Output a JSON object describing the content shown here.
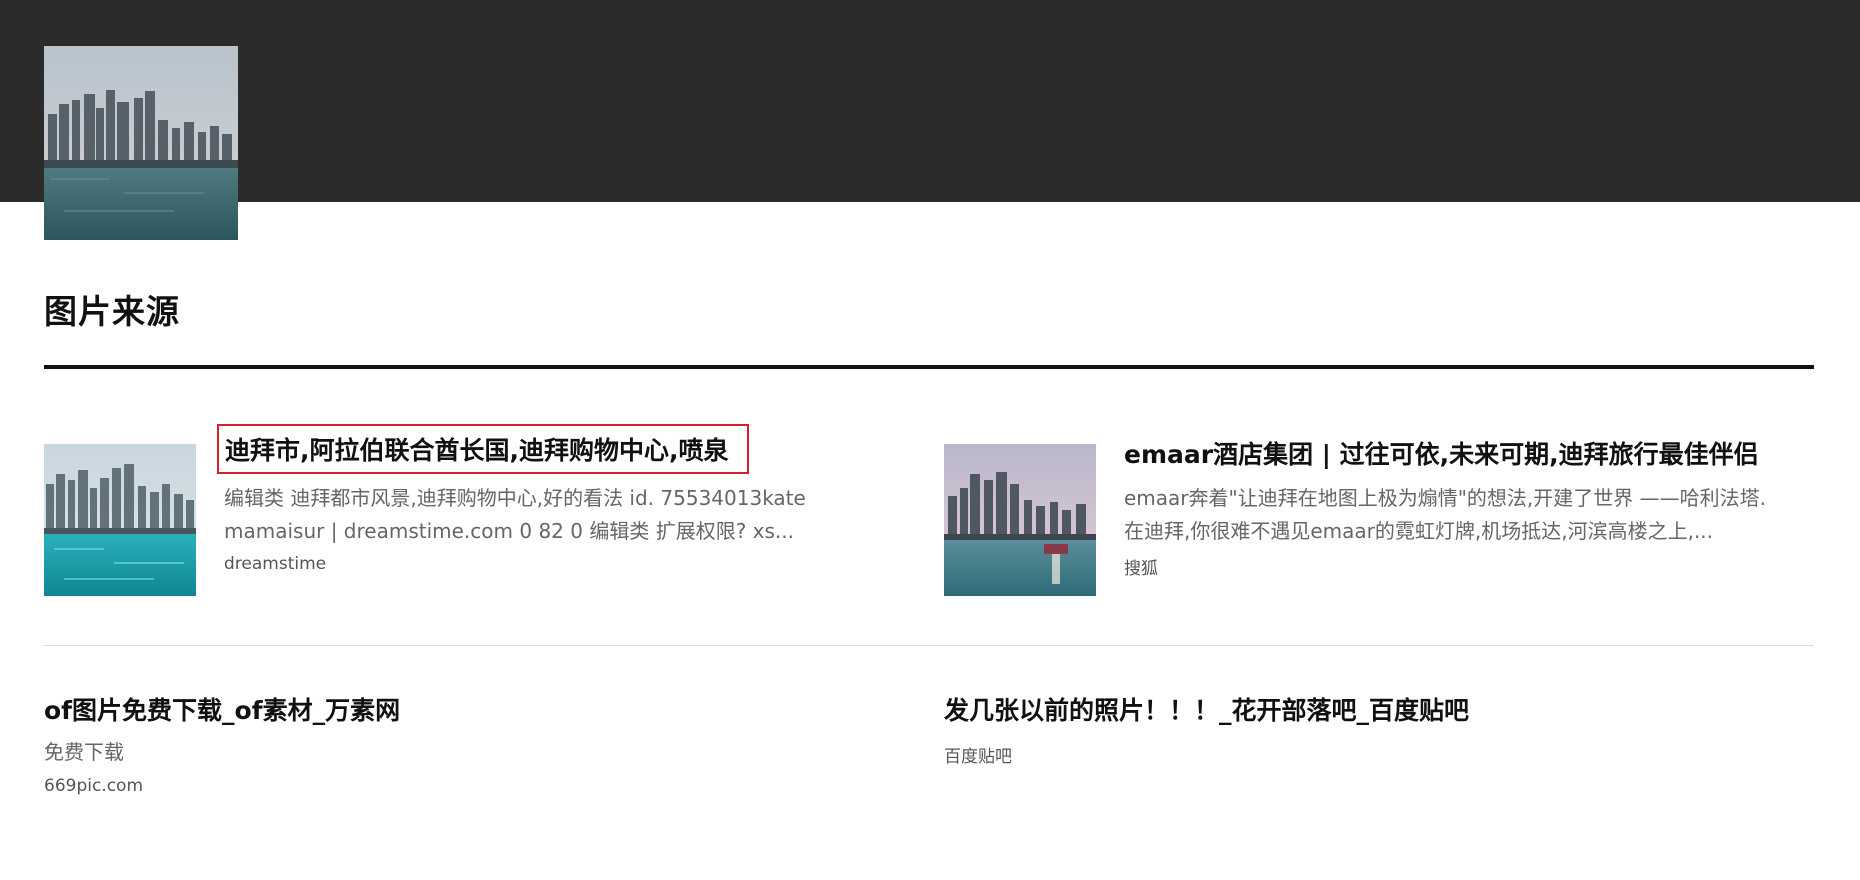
{
  "hero": {
    "image_name": "dubai-skyline-image"
  },
  "section": {
    "title": "图片来源"
  },
  "results": [
    {
      "title": "迪拜市,阿拉伯联合酋长国,迪拜购物中心,喷泉",
      "description": "编辑类 迪拜都市风景,迪拜购物中心,好的看法 id. 75534013kate mamaisur | dreamstime.com 0 82 0 编辑类 扩展权限? xs...",
      "source": "dreamstime",
      "highlighted": true,
      "highlight_color": "#d9202a"
    },
    {
      "title": "emaar酒店集团 | 过往可依,未来可期,迪拜旅行最佳伴侣",
      "description": "emaar奔着\"让迪拜在地图上极为煽情\"的想法,开建了世界 ——哈利法塔. 在迪拜,你很难不遇见emaar的霓虹灯牌,机场抵达,河滨高楼之上,...",
      "source": "搜狐"
    },
    {
      "title": "of图片免费下载_of素材_万素网",
      "description": "免费下载",
      "source": "669pic.com"
    },
    {
      "title": "发几张以前的照片！！！_花开部落吧_百度贴吧",
      "source": "百度贴吧"
    }
  ],
  "colors": {
    "top_band": "#2b2b2b",
    "title_text": "#111111",
    "description_text": "#666666",
    "divider": "#dcdcdc"
  }
}
